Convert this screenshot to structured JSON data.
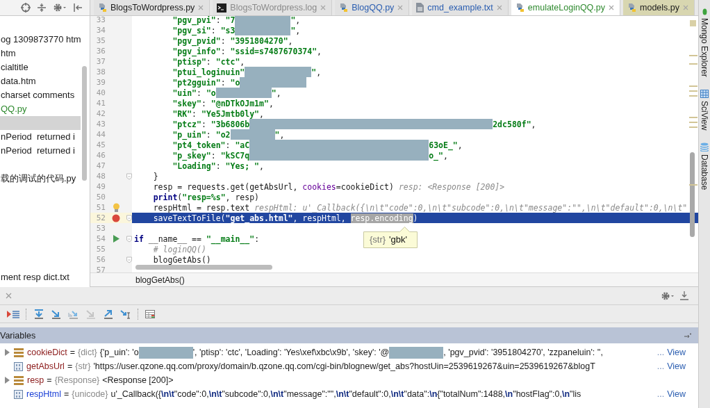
{
  "tabs": [
    {
      "label": "BlogsToWordpress.py",
      "kind": "python",
      "color": "#1a1a1a",
      "selected": false,
      "highlighted": false
    },
    {
      "label": "BlogsToWordpress.log",
      "kind": "terminal",
      "color": "#8a8a8a",
      "selected": false,
      "highlighted": false
    },
    {
      "label": "BlogQQ.py",
      "kind": "python",
      "color": "#2a5db0",
      "selected": false,
      "highlighted": false
    },
    {
      "label": "cmd_example.txt",
      "kind": "text",
      "color": "#2a5db0",
      "selected": false,
      "highlighted": false
    },
    {
      "label": "emulateLoginQQ.py",
      "kind": "python",
      "color": "#2f8a2f",
      "selected": true,
      "highlighted": false
    },
    {
      "label": "models.py",
      "kind": "python",
      "color": "#1a1a1a",
      "selected": false,
      "highlighted": true
    }
  ],
  "project_tree": {
    "items": [
      {
        "label": "og 1309873770 htm",
        "color": "#1a1a1a",
        "selected": false
      },
      {
        "label": "htm",
        "color": "#1a1a1a",
        "selected": false
      },
      {
        "label": "cialtitle",
        "color": "#1a1a1a",
        "selected": false
      },
      {
        "label": "data.htm",
        "color": "#1a1a1a",
        "selected": false
      },
      {
        "label": "charset comments",
        "color": "#1a1a1a",
        "selected": false
      },
      {
        "label": "QQ.py",
        "color": "#2f8a2f",
        "selected": false
      },
      {
        "selected": true
      },
      {
        "label": "nPeriod  returned i",
        "color": "#1a1a1a",
        "selected": false
      },
      {
        "label": "nPeriod  returned i",
        "color": "#1a1a1a",
        "selected": false
      },
      {
        "label": "载的调试的代码.py",
        "color": "#1a1a1a",
        "selected": false
      },
      {
        "label": "ment resp dict.txt",
        "color": "#1a1a1a",
        "selected": false
      }
    ]
  },
  "editor": {
    "lines": [
      {
        "number": "33",
        "kind": "plain",
        "fold": false,
        "current": false,
        "segments": [
          {
            "kind": "string",
            "text": "        \"pgv_pvi\""
          },
          {
            "kind": "plain",
            "text": ": "
          },
          {
            "kind": "string",
            "text": "\"7"
          },
          {
            "kind": "mask_short"
          },
          {
            "kind": "string",
            "text": "\""
          },
          {
            "kind": "plain",
            "text": ","
          }
        ]
      },
      {
        "number": "34",
        "kind": "plain",
        "fold": false,
        "current": false,
        "segments": [
          {
            "kind": "string",
            "text": "        \"pgv_si\""
          },
          {
            "kind": "plain",
            "text": ": "
          },
          {
            "kind": "string",
            "text": "\"s3"
          },
          {
            "kind": "mask_short"
          },
          {
            "kind": "string",
            "text": "\""
          },
          {
            "kind": "plain",
            "text": ","
          }
        ]
      },
      {
        "number": "35",
        "kind": "plain",
        "fold": false,
        "current": false,
        "segments": [
          {
            "kind": "string",
            "text": "        \"pgv_pvid\""
          },
          {
            "kind": "plain",
            "text": ": "
          },
          {
            "kind": "string",
            "text": "\"3951804270\""
          },
          {
            "kind": "plain",
            "text": ","
          }
        ]
      },
      {
        "number": "36",
        "kind": "plain",
        "fold": false,
        "current": false,
        "segments": [
          {
            "kind": "string",
            "text": "        \"pgv_info\""
          },
          {
            "kind": "plain",
            "text": ": "
          },
          {
            "kind": "string",
            "text": "\"ssid=s7487670374\""
          },
          {
            "kind": "plain",
            "text": ","
          }
        ]
      },
      {
        "number": "37",
        "kind": "plain",
        "fold": false,
        "current": false,
        "segments": [
          {
            "kind": "string",
            "text": "        \"ptisp\""
          },
          {
            "kind": "plain",
            "text": ": "
          },
          {
            "kind": "string",
            "text": "\"ctc\""
          },
          {
            "kind": "plain",
            "text": ","
          }
        ]
      },
      {
        "number": "38",
        "kind": "plain",
        "fold": false,
        "current": false,
        "segments": [
          {
            "kind": "string",
            "text": "        \"ptui_loginuin\""
          },
          {
            "kind": "mask_medium"
          },
          {
            "kind": "string",
            "text": "\""
          },
          {
            "kind": "plain",
            "text": ","
          }
        ]
      },
      {
        "number": "39",
        "kind": "plain",
        "fold": false,
        "current": false,
        "segments": [
          {
            "kind": "string",
            "text": "        \"pt2gguin\""
          },
          {
            "kind": "plain",
            "text": ": "
          },
          {
            "kind": "string",
            "text": "\"o"
          },
          {
            "kind": "mask_medium"
          }
        ]
      },
      {
        "number": "40",
        "kind": "plain",
        "fold": false,
        "current": false,
        "segments": [
          {
            "kind": "string",
            "text": "        \"uin\""
          },
          {
            "kind": "plain",
            "text": ": "
          },
          {
            "kind": "string",
            "text": "\"o"
          },
          {
            "kind": "mask_short"
          },
          {
            "kind": "string",
            "text": "\""
          },
          {
            "kind": "plain",
            "text": ","
          }
        ]
      },
      {
        "number": "41",
        "kind": "plain",
        "fold": false,
        "current": false,
        "segments": [
          {
            "kind": "string",
            "text": "        \"skey\""
          },
          {
            "kind": "plain",
            "text": ": "
          },
          {
            "kind": "string",
            "text": "\"@nDTkOJm1m\""
          },
          {
            "kind": "plain",
            "text": ","
          }
        ]
      },
      {
        "number": "42",
        "kind": "plain",
        "fold": false,
        "current": false,
        "segments": [
          {
            "kind": "string",
            "text": "        \"RK\""
          },
          {
            "kind": "plain",
            "text": ": "
          },
          {
            "kind": "string",
            "text": "\"Ye5Jmtb0ly\""
          },
          {
            "kind": "plain",
            "text": ","
          }
        ]
      },
      {
        "number": "43",
        "kind": "plain",
        "fold": false,
        "current": false,
        "segments": [
          {
            "kind": "string",
            "text": "        \"ptcz\""
          },
          {
            "kind": "plain",
            "text": ": "
          },
          {
            "kind": "string",
            "text": "\"3b6806b"
          },
          {
            "kind": "mask_long"
          },
          {
            "kind": "string",
            "text": "2dc580f\""
          },
          {
            "kind": "plain",
            "text": ","
          }
        ]
      },
      {
        "number": "44",
        "kind": "plain",
        "fold": false,
        "current": false,
        "segments": [
          {
            "kind": "string",
            "text": "        \"p_uin\""
          },
          {
            "kind": "plain",
            "text": ": "
          },
          {
            "kind": "string",
            "text": "\"o2"
          },
          {
            "kind": "mask_small"
          },
          {
            "kind": "string",
            "text": "\""
          },
          {
            "kind": "plain",
            "text": ","
          }
        ]
      },
      {
        "number": "45",
        "kind": "plain",
        "fold": false,
        "current": false,
        "segments": [
          {
            "kind": "string",
            "text": "        \"pt4_token\""
          },
          {
            "kind": "plain",
            "text": ": "
          },
          {
            "kind": "string",
            "text": "\"aC"
          },
          {
            "kind": "mask_wide"
          },
          {
            "kind": "string",
            "text": "63oE_\""
          },
          {
            "kind": "plain",
            "text": ","
          }
        ]
      },
      {
        "number": "46",
        "kind": "plain",
        "fold": false,
        "current": false,
        "segments": [
          {
            "kind": "string",
            "text": "        \"p_skey\""
          },
          {
            "kind": "plain",
            "text": ": "
          },
          {
            "kind": "string",
            "text": "\"kSC7q"
          },
          {
            "kind": "mask_wide"
          },
          {
            "kind": "string",
            "text": "o_\""
          },
          {
            "kind": "plain",
            "text": ","
          }
        ]
      },
      {
        "number": "47",
        "kind": "plain",
        "fold": false,
        "current": false,
        "segments": [
          {
            "kind": "string",
            "text": "        \"Loading\""
          },
          {
            "kind": "plain",
            "text": ": "
          },
          {
            "kind": "string",
            "text": "\"Yes; \""
          },
          {
            "kind": "plain",
            "text": ","
          }
        ]
      },
      {
        "number": "48",
        "kind": "plain",
        "fold": true,
        "current": false,
        "segments": [
          {
            "kind": "plain",
            "text": "    }"
          }
        ]
      },
      {
        "number": "49",
        "kind": "plain",
        "fold": false,
        "current": false,
        "segments": [
          {
            "kind": "plain",
            "text": "    resp = requests.get(getAbsUrl, "
          },
          {
            "kind": "param",
            "text": "cookies"
          },
          {
            "kind": "plain",
            "text": "=cookieDict)"
          },
          {
            "kind": "hint",
            "text": "resp: <Response [200]>"
          }
        ]
      },
      {
        "number": "50",
        "kind": "plain",
        "fold": false,
        "current": false,
        "segments": [
          {
            "kind": "keyword",
            "text": "    print"
          },
          {
            "kind": "plain",
            "text": "("
          },
          {
            "kind": "string",
            "text": "\"resp=%s\""
          },
          {
            "kind": "plain",
            "text": ", resp)"
          }
        ]
      },
      {
        "number": "51",
        "kind": "bulb",
        "fold": false,
        "current": false,
        "segments": [
          {
            "kind": "plain",
            "text": "    respHtml = resp.text"
          },
          {
            "kind": "hint",
            "text": "respHtml: u'_Callback({\\n\\t\"code\":0,\\n\\t\"subcode\":0,\\n\\t\"message\":\"\",\\n\\t\"default\":0,\\n\\t\""
          }
        ]
      },
      {
        "number": "52",
        "kind": "breakpoint",
        "fold": true,
        "current": true,
        "segments": [
          {
            "kind": "plain",
            "text": "    saveTextToFile("
          },
          {
            "kind": "string",
            "text": "\"get_abs.html\""
          },
          {
            "kind": "plain",
            "text": ", respHtml, "
          },
          {
            "kind": "selection",
            "text": "resp.encoding"
          },
          {
            "kind": "plain",
            "text": ")"
          }
        ]
      },
      {
        "number": "53",
        "kind": "plain",
        "fold": false,
        "current": false
      },
      {
        "number": "54",
        "kind": "run",
        "fold": true,
        "current": false,
        "segments": [
          {
            "kind": "keyword",
            "text": "if"
          },
          {
            "kind": "plain",
            "text": " __name__ == "
          },
          {
            "kind": "string",
            "text": "\"__main__\""
          },
          {
            "kind": "plain",
            "text": ":"
          }
        ]
      },
      {
        "number": "55",
        "kind": "plain",
        "fold": false,
        "current": false,
        "segments": [
          {
            "kind": "comment",
            "text": "    # loginQQ()"
          }
        ]
      },
      {
        "number": "56",
        "kind": "plain",
        "fold": true,
        "current": false,
        "segments": [
          {
            "kind": "plain",
            "text": "    blogGetAbs()"
          }
        ]
      },
      {
        "number": "57",
        "kind": "plain",
        "fold": false,
        "current": false
      }
    ],
    "tooltip": {
      "type": "{str}",
      "value": "'gbk'"
    },
    "breadcrumb": "blogGetAbs()"
  },
  "debugger": {
    "variables_title": "Variables",
    "variables": [
      {
        "expandable": true,
        "kind": "struct",
        "name": "cookieDict",
        "changed": false,
        "operator": "=",
        "type": "{dict}",
        "parts": [
          {
            "text": "{'p_uin': 'o"
          },
          {
            "kind": "mask"
          },
          {
            "text": "', 'ptisp': 'ctc', 'Loading': 'Yes\\xef\\xbc\\x9b', 'skey': '@"
          },
          {
            "kind": "mask"
          },
          {
            "text": ", 'pgv_pvid': '3951804270', 'zzpaneluin': '',"
          }
        ],
        "more": "...",
        "link": "View"
      },
      {
        "expandable": false,
        "kind": "primitive",
        "name": "getAbsUrl",
        "changed": false,
        "operator": "=",
        "type": "{str}",
        "parts": [
          {
            "text": "'https://user.qzone.qq.com/proxy/domain/b.qzone.qq.com/cgi-bin/blognew/get_abs?hostUin=2539619267&uin=2539619267&blogT"
          }
        ],
        "more": "...",
        "link": "View"
      },
      {
        "expandable": true,
        "kind": "struct",
        "name": "resp",
        "changed": false,
        "operator": "=",
        "type": "{Response}",
        "parts": [
          {
            "text": "<Response [200]>"
          }
        ]
      },
      {
        "expandable": false,
        "kind": "primitive",
        "name": "respHtml",
        "changed": true,
        "operator": "=",
        "type": "{unicode}",
        "parts": [
          {
            "text": "u'_Callback({**\\n\\t**\"code\":0,**\\n\\t**\"subcode\":0,**\\n\\t**\"message\":\"\",**\\n\\t**\"default\":0,**\\n\\t**\"data\":**\\n**{\"totalNum\":1488,**\\n**\"hostFlag\":0,**\\n**\"lis"
          }
        ],
        "more": "...",
        "link": "View"
      }
    ]
  },
  "side_tools": [
    {
      "label": "Mongo Explorer",
      "kind": "dot"
    },
    {
      "label": "SciView",
      "kind": "grid"
    },
    {
      "label": "Database",
      "kind": "cylinder"
    }
  ]
}
